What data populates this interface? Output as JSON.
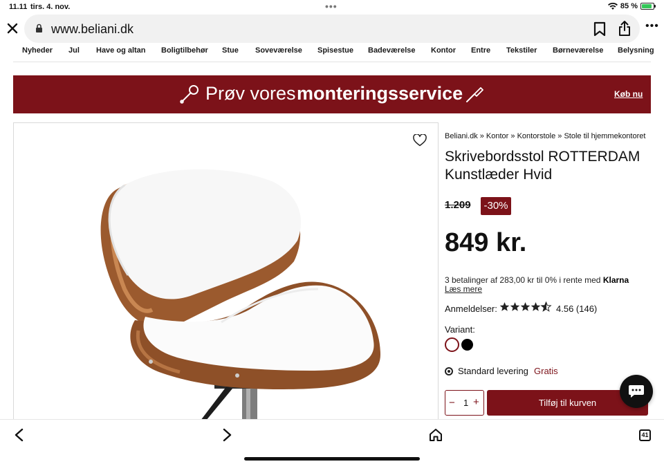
{
  "status": {
    "time": "11.11",
    "date": "tirs. 4. nov.",
    "battery": "85 %",
    "battery_level": 0.85
  },
  "browser": {
    "url": "www.beliani.dk",
    "open_tabs": "41"
  },
  "nav": {
    "items": [
      "Nyheder",
      "Jul",
      "Have og altan",
      "Boligtilbehør",
      "Stue",
      "Soveværelse",
      "Spisestue",
      "Badeværelse",
      "Kontor",
      "Entre",
      "Tekstiler",
      "Børneværelse",
      "Belysning"
    ]
  },
  "banner": {
    "text_prefix": "Prøv vores",
    "text_bold": "monteringsservice",
    "cta": "Køb nu"
  },
  "product": {
    "breadcrumb": "Beliani.dk » Kontor » Kontorstole » Stole til hjemmekontoret",
    "title": "Skrivebordsstol ROTTERDAM Kunstlæder Hvid",
    "old_price": "1.209",
    "discount": "-30%",
    "price": "849 kr.",
    "klarna_text": "3 betalinger af 283,00 kr til 0% i rente med",
    "klarna_brand": "Klarna",
    "klarna_more": "Læs mere",
    "reviews_label": "Anmeldelser:",
    "rating": "4.56 (146)",
    "rating_value": 4.56,
    "variant_label": "Variant:",
    "delivery": "Standard levering",
    "delivery_price": "Gratis",
    "quantity": "1",
    "add_to_cart": "Tilføj til kurven"
  },
  "colors": {
    "brand": "#7c1219",
    "swatches": [
      "#ffffff",
      "#000000"
    ]
  }
}
